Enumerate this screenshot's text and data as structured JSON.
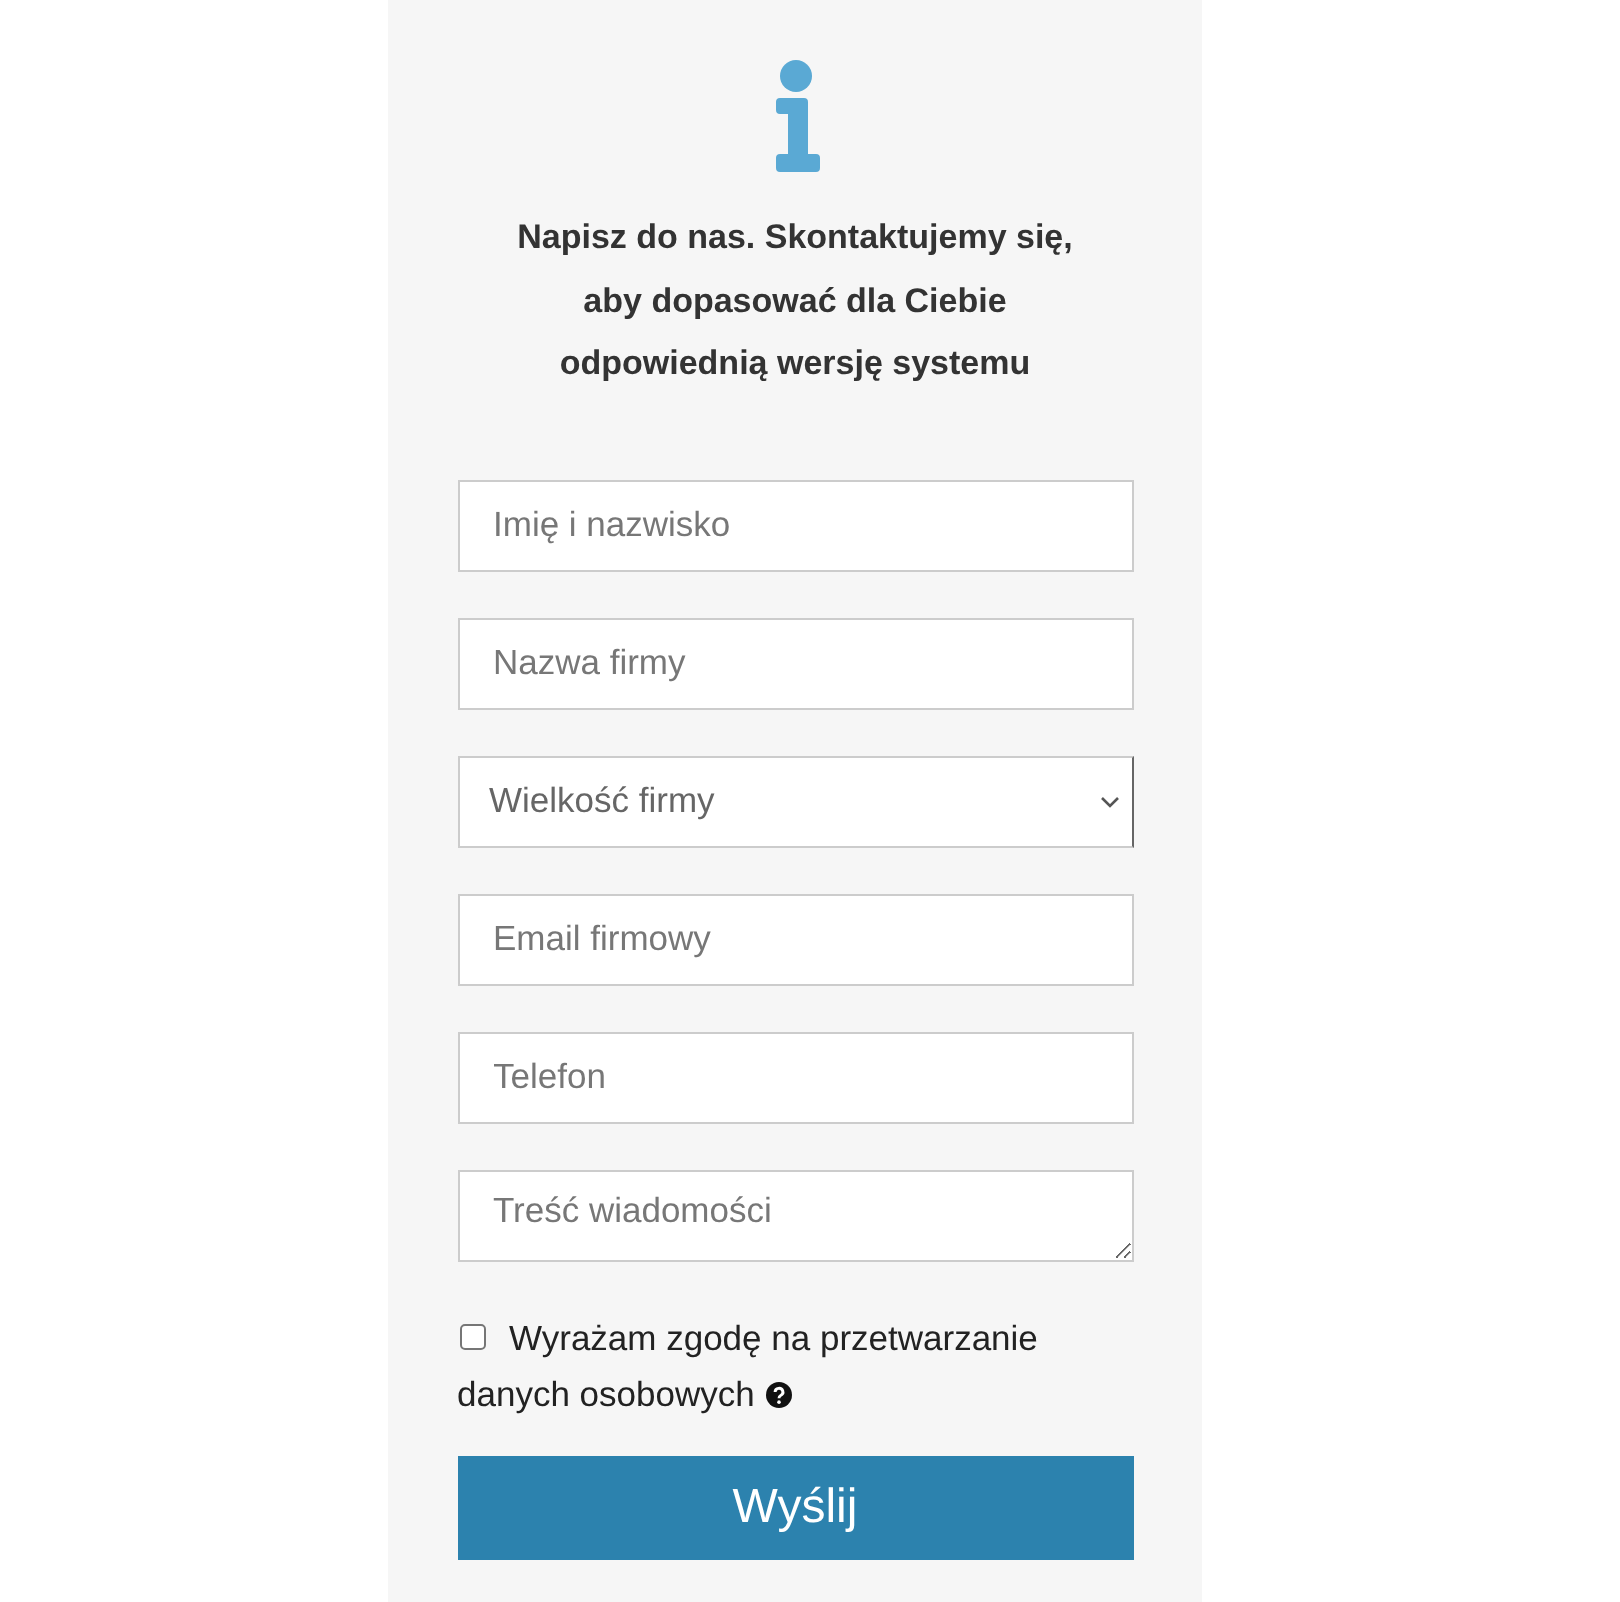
{
  "heading": [
    "Napisz do nas. Skontaktujemy się,",
    "aby dopasować dla Ciebie",
    "odpowiednią wersję systemu"
  ],
  "fields": [
    {
      "kind": "text",
      "placeholder": "Imię i nazwisko"
    },
    {
      "kind": "text",
      "placeholder": "Nazwa firmy"
    },
    {
      "kind": "select",
      "placeholder": "Wielkość firmy"
    },
    {
      "kind": "text",
      "placeholder": "Email firmowy"
    },
    {
      "kind": "text",
      "placeholder": "Telefon"
    },
    {
      "kind": "textarea",
      "placeholder": "Treść wiadomości"
    }
  ],
  "consent": {
    "label_lines": [
      "Wyrażam zgodę na przetwarzanie",
      "danych osobowych"
    ],
    "checked": false
  },
  "submit": "Wyślij"
}
